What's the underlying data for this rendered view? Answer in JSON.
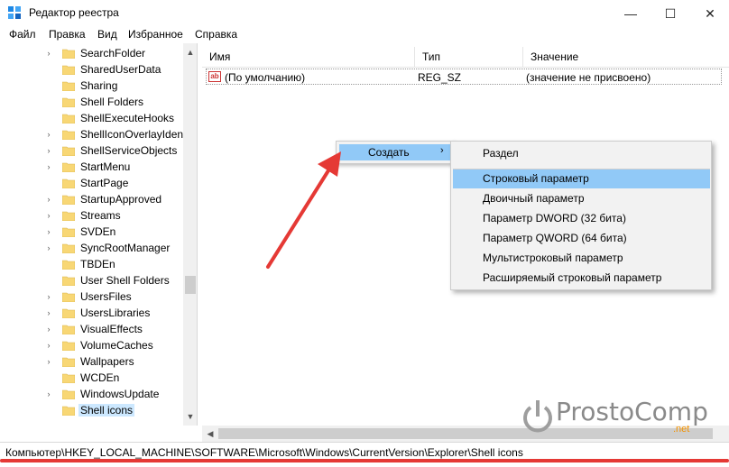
{
  "window": {
    "title": "Редактор реестра",
    "minimize": "—",
    "maximize": "☐",
    "close": "✕"
  },
  "menu": [
    "Файл",
    "Правка",
    "Вид",
    "Избранное",
    "Справка"
  ],
  "tree": {
    "items": [
      {
        "label": "SearchFolder",
        "expandable": true
      },
      {
        "label": "SharedUserData",
        "expandable": false
      },
      {
        "label": "Sharing",
        "expandable": false
      },
      {
        "label": "Shell Folders",
        "expandable": false
      },
      {
        "label": "ShellExecuteHooks",
        "expandable": false
      },
      {
        "label": "ShellIconOverlayIdent",
        "expandable": true
      },
      {
        "label": "ShellServiceObjects",
        "expandable": true
      },
      {
        "label": "StartMenu",
        "expandable": true
      },
      {
        "label": "StartPage",
        "expandable": false
      },
      {
        "label": "StartupApproved",
        "expandable": true
      },
      {
        "label": "Streams",
        "expandable": true
      },
      {
        "label": "SVDEn",
        "expandable": true
      },
      {
        "label": "SyncRootManager",
        "expandable": true
      },
      {
        "label": "TBDEn",
        "expandable": false
      },
      {
        "label": "User Shell Folders",
        "expandable": false
      },
      {
        "label": "UsersFiles",
        "expandable": true
      },
      {
        "label": "UsersLibraries",
        "expandable": true
      },
      {
        "label": "VisualEffects",
        "expandable": true
      },
      {
        "label": "VolumeCaches",
        "expandable": true
      },
      {
        "label": "Wallpapers",
        "expandable": true
      },
      {
        "label": "WCDEn",
        "expandable": false
      },
      {
        "label": "WindowsUpdate",
        "expandable": true
      },
      {
        "label": "Shell icons",
        "expandable": false,
        "selected": true
      }
    ]
  },
  "columns": {
    "name": "Имя",
    "type": "Тип",
    "value": "Значение"
  },
  "values": [
    {
      "icon": "ab",
      "name": "(По умолчанию)",
      "type": "REG_SZ",
      "value": "(значение не присвоено)"
    }
  ],
  "context_menu": {
    "create_label": "Создать",
    "submenu_arrow": "›"
  },
  "submenu": {
    "items": [
      {
        "label": "Раздел"
      },
      {
        "label": "Строковый параметр",
        "highlighted": true
      },
      {
        "label": "Двоичный параметр"
      },
      {
        "label": "Параметр DWORD (32 бита)"
      },
      {
        "label": "Параметр QWORD (64 бита)"
      },
      {
        "label": "Мультистроковый параметр"
      },
      {
        "label": "Расширяемый строковый параметр"
      }
    ]
  },
  "watermark": {
    "text": "ProstoComp",
    "suffix": ".net"
  },
  "statusbar": {
    "path": "Компьютер\\HKEY_LOCAL_MACHINE\\SOFTWARE\\Microsoft\\Windows\\CurrentVersion\\Explorer\\Shell icons"
  },
  "colors": {
    "accent_arrow": "#e53935",
    "highlight": "#91c9f7",
    "folder": "#f8d775"
  }
}
